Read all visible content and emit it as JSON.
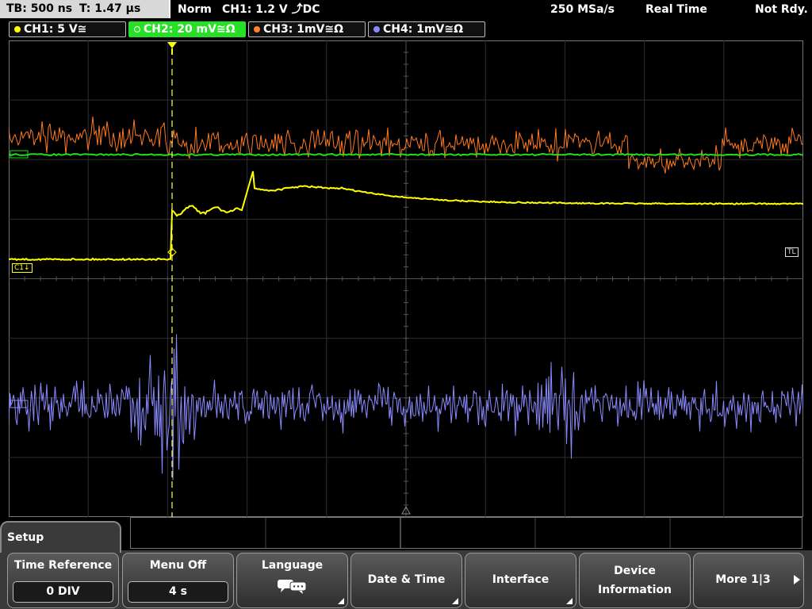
{
  "topbar": {
    "timebase": "TB: 500 ns",
    "trigger_time": "T: 1.47 µs",
    "mode": "Norm",
    "trigger": "CH1: 1.2 V ⤴DC",
    "sample_rate": "250 MSa/s",
    "acq_mode": "Real Time",
    "status": "Not Rdy."
  },
  "channels": [
    {
      "label": "CH1: 5 V≅",
      "color": "#ffff00",
      "active": false
    },
    {
      "label": "CH2: 20 mV≅Ω",
      "color": "#33dd33",
      "active": true
    },
    {
      "label": "CH3: 1mV≅Ω",
      "color": "#ff8030",
      "active": false
    },
    {
      "label": "CH4: 1mV≅Ω",
      "color": "#8888ff",
      "active": false
    }
  ],
  "markers": {
    "ch1_ref": "C1↓",
    "trigger_level": "TL"
  },
  "waveform_colors": {
    "ch1": "#ffff00",
    "ch2": "#22dd22",
    "ch3": "#ff7a20",
    "ch4": "#8a8aff"
  },
  "menu": {
    "title": "Setup",
    "softkeys": [
      {
        "label": "Time Reference",
        "value": "0 DIV"
      },
      {
        "label": "Menu Off",
        "value": "4 s"
      },
      {
        "label": "Language",
        "icon": "speech-bubbles-icon"
      },
      {
        "label": "Date & Time"
      },
      {
        "label": "Interface"
      },
      {
        "label1": "Device",
        "label2": "Information"
      },
      {
        "label": "More 1|3"
      }
    ]
  }
}
